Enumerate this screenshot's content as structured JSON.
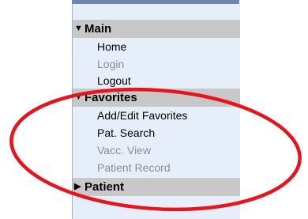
{
  "menu": {
    "sections": {
      "main": {
        "title": "Main",
        "items": [
          "Home",
          "Login",
          "Logout"
        ]
      },
      "favorites": {
        "title": "Favorites",
        "items": [
          "Add/Edit Favorites",
          "Pat. Search",
          "Vacc. View",
          "Patient Record"
        ]
      },
      "patient": {
        "title": "Patient"
      }
    }
  },
  "annotation": {
    "color": "#e8141b"
  }
}
